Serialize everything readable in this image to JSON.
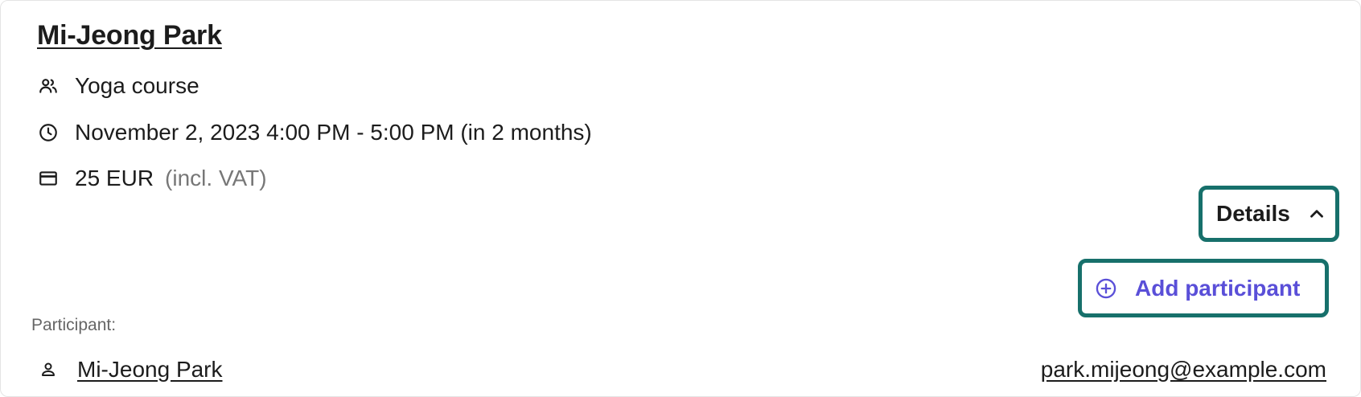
{
  "booking": {
    "customer_name": "Mi-Jeong Park",
    "course": "Yoga course",
    "datetime": "November 2, 2023 4:00 PM - 5:00 PM (in 2 months)",
    "price": "25 EUR",
    "vat_note": "(incl. VAT)"
  },
  "actions": {
    "details_label": "Details",
    "add_participant_label": "Add participant"
  },
  "participants": {
    "heading": "Participant:",
    "items": [
      {
        "name": "Mi-Jeong Park",
        "email": "park.mijeong@example.com"
      }
    ]
  },
  "colors": {
    "focus_outline": "#17706b",
    "accent": "#5a4fd8",
    "muted_text": "#777777"
  },
  "icons": {
    "course": "people-icon",
    "datetime": "clock-icon",
    "price": "credit-card-icon",
    "details": "chevron-up-icon",
    "add": "plus-circle-icon",
    "participant": "person-icon"
  }
}
